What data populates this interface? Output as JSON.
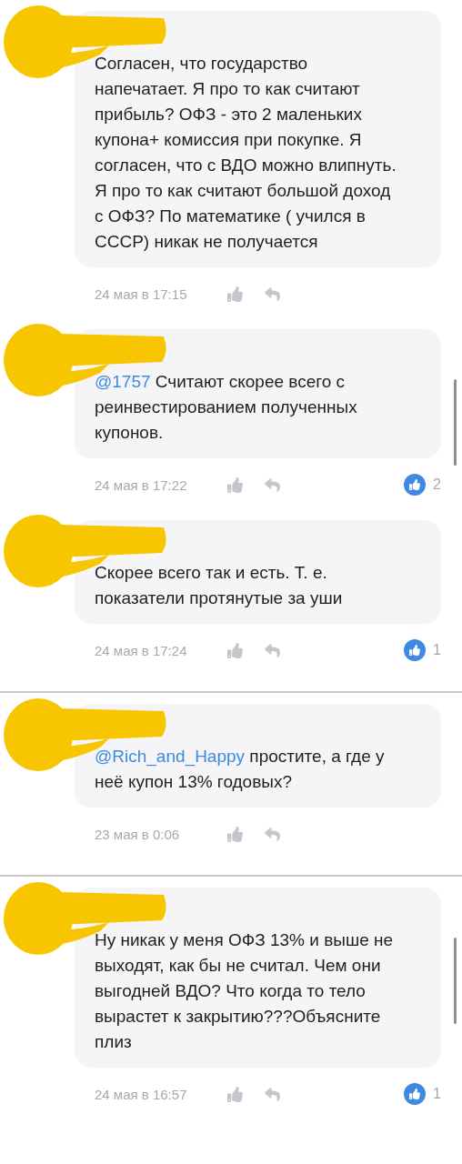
{
  "segments": [
    {
      "comments": [
        {
          "text": "Согласен, что государство напечатает. Я про то как считают прибыль? ОФЗ - это 2 маленьких купона+ комиссия при покупке. Я согласен, что с ВДО можно влипнуть. Я про то как считают большой доход с ОФЗ? По математике ( учился в СССР) никак не получается",
          "date": "24 мая в 17:15",
          "scrollbar": false
        },
        {
          "mention": "@1757",
          "text": "Считают скорее всего с реинвестированием полученных купонов.",
          "date": "24 мая в 17:22",
          "like_count": "2",
          "scrollbar": true
        },
        {
          "text": "Скорее всего так и есть. Т. е. показатели  протянутые за уши",
          "date": "24 мая в 17:24",
          "like_count": "1",
          "scrollbar": false
        }
      ]
    },
    {
      "comments": [
        {
          "mention": "@Rich_and_Happy",
          "text": "простите, а где у неё купон 13% годовых?",
          "date": "23 мая в 0:06",
          "scrollbar": false
        }
      ]
    },
    {
      "comments": [
        {
          "text": "Ну никак у меня ОФЗ 13% и выше не выходят, как бы не считал. Чем они выгодней ВДО? Что когда то тело вырастет к закрытию???Объясните плиз",
          "date": "24 мая в 16:57",
          "like_count": "1",
          "scrollbar": true
        }
      ]
    }
  ]
}
